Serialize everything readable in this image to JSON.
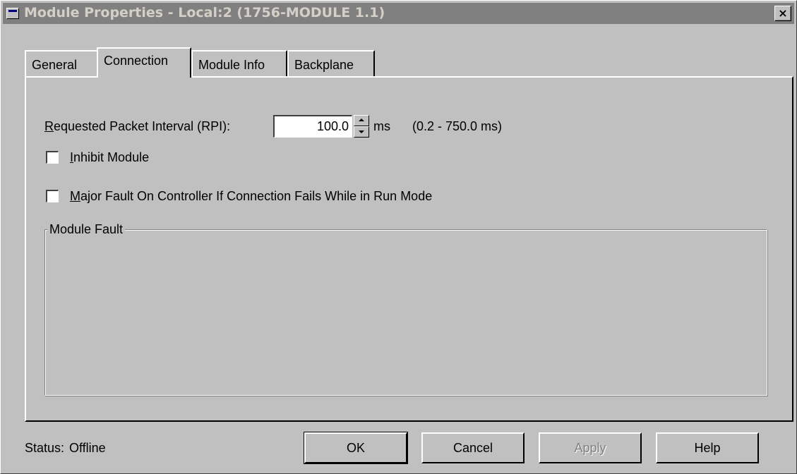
{
  "window": {
    "title": "Module Properties - Local:2 (1756-MODULE 1.1)",
    "close_label": "×"
  },
  "tabs": [
    {
      "label": "General",
      "active": false
    },
    {
      "label": "Connection",
      "active": true
    },
    {
      "label": "Module Info",
      "active": false
    },
    {
      "label": "Backplane",
      "active": false
    }
  ],
  "connection": {
    "rpi_label_mnemonic": "R",
    "rpi_label_rest": "equested Packet Interval (RPI):",
    "rpi_value": "100.0",
    "rpi_unit": "ms",
    "rpi_range": "(0.2 - 750.0 ms)",
    "inhibit_mnemonic": "I",
    "inhibit_rest": "nhibit Module",
    "inhibit_checked": false,
    "major_fault_mnemonic": "M",
    "major_fault_rest": "ajor Fault On Controller If Connection Fails While in Run Mode",
    "major_fault_checked": false,
    "module_fault_label": "Module Fault",
    "module_fault_text": ""
  },
  "footer": {
    "status_label": "Status:",
    "status_value": "Offline"
  },
  "buttons": {
    "ok": "OK",
    "cancel": "Cancel",
    "apply": "Apply",
    "help": "Help"
  },
  "colors": {
    "face": "#c0c0c0",
    "title_inactive": "#808080",
    "title_text": "#d4d0c8"
  }
}
